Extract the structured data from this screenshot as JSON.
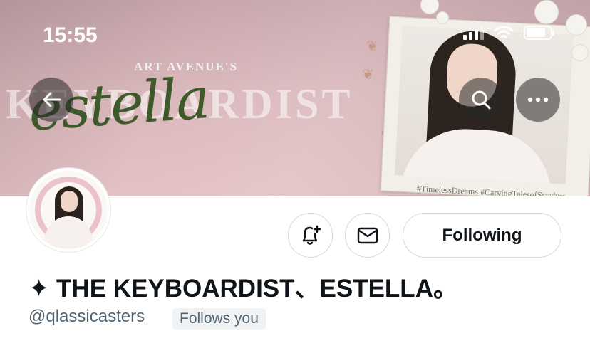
{
  "status_bar": {
    "time": "15:55"
  },
  "banner": {
    "subtitle": "ART AVENUE'S",
    "title_big": "KEYBOARDIST",
    "title_script": "estella",
    "hashtags": "#TimelessDreams  #CarvingTalesofStardust"
  },
  "nav": {
    "back_icon": "arrow-left-icon",
    "search_icon": "search-icon",
    "more_icon": "more-horizontal-icon"
  },
  "profile": {
    "display_name": "✦ THE KEYBOARDIST、ESTELLA。",
    "handle": "@qlassicasters",
    "follows_you": "Follows you"
  },
  "actions": {
    "notify_icon": "bell-plus-icon",
    "message_icon": "envelope-icon",
    "following_label": "Following"
  },
  "colors": {
    "text_primary": "#0f1419",
    "text_secondary": "#536471",
    "border": "#cfd9de",
    "badge_bg": "#eff3f4"
  }
}
